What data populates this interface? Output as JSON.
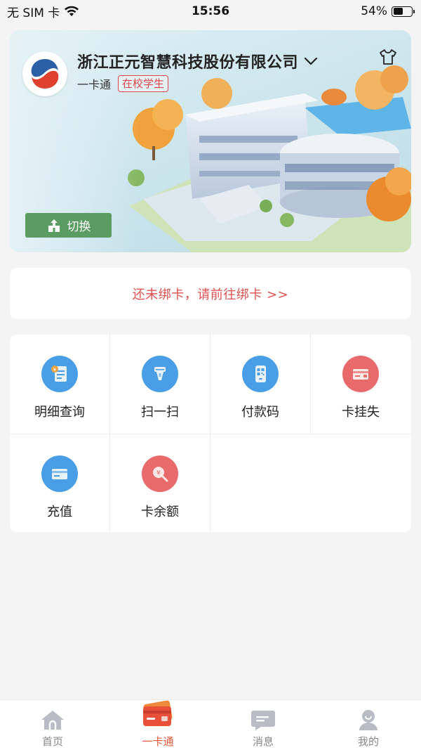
{
  "status_bar": {
    "carrier": "无 SIM 卡",
    "time": "15:56",
    "battery_percent": "54%",
    "battery_level": 0.54
  },
  "card": {
    "company": "浙江正元智慧科技股份有限公司",
    "card_type": "一卡通",
    "status": "在校学生",
    "switch_label": "切换"
  },
  "bind_notice": "还未绑卡，请前往绑卡 >>",
  "services": [
    {
      "label": "明细查询",
      "icon": "bill-detail-icon"
    },
    {
      "label": "扫一扫",
      "icon": "scan-icon"
    },
    {
      "label": "付款码",
      "icon": "payment-code-icon"
    },
    {
      "label": "卡挂失",
      "icon": "card-lost-icon"
    },
    {
      "label": "充值",
      "icon": "recharge-icon"
    },
    {
      "label": "卡余额",
      "icon": "balance-icon"
    }
  ],
  "tabs": [
    {
      "label": "首页",
      "icon": "home-icon"
    },
    {
      "label": "一卡通",
      "icon": "card-icon",
      "active": true
    },
    {
      "label": "消息",
      "icon": "message-icon"
    },
    {
      "label": "我的",
      "icon": "profile-icon"
    }
  ],
  "colors": {
    "accent": "#e65b3a",
    "alert_red": "#e05050",
    "switch_green": "#5a9c62",
    "icon_blue": "#3d95e6",
    "icon_red": "#e76a6a"
  }
}
